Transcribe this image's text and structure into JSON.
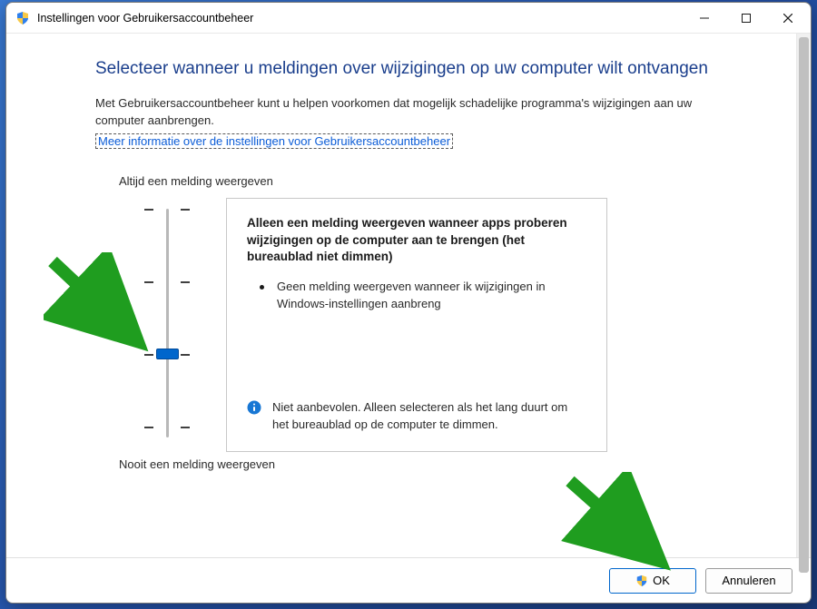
{
  "window": {
    "title": "Instellingen voor Gebruikersaccountbeheer"
  },
  "heading": "Selecteer wanneer u meldingen over wijzigingen op uw computer wilt ontvangen",
  "intro": "Met Gebruikersaccountbeheer kunt u helpen voorkomen dat mogelijk schadelijke programma's wijzigingen aan uw computer aanbrengen.",
  "help_link": "Meer informatie over de instellingen voor Gebruikersaccountbeheer",
  "slider": {
    "top_label": "Altijd een melding weergeven",
    "bottom_label": "Nooit een melding weergeven",
    "ticks": 4,
    "selected_index": 2
  },
  "description": {
    "title": "Alleen een melding weergeven wanneer apps proberen wijzigingen op de computer aan te brengen (het bureaublad niet dimmen)",
    "bullet": "Geen melding weergeven wanneer ik wijzigingen in Windows-instellingen aanbreng",
    "note": "Niet aanbevolen. Alleen selecteren als het lang duurt om het bureaublad op de computer te dimmen."
  },
  "buttons": {
    "ok": "OK",
    "cancel": "Annuleren"
  }
}
